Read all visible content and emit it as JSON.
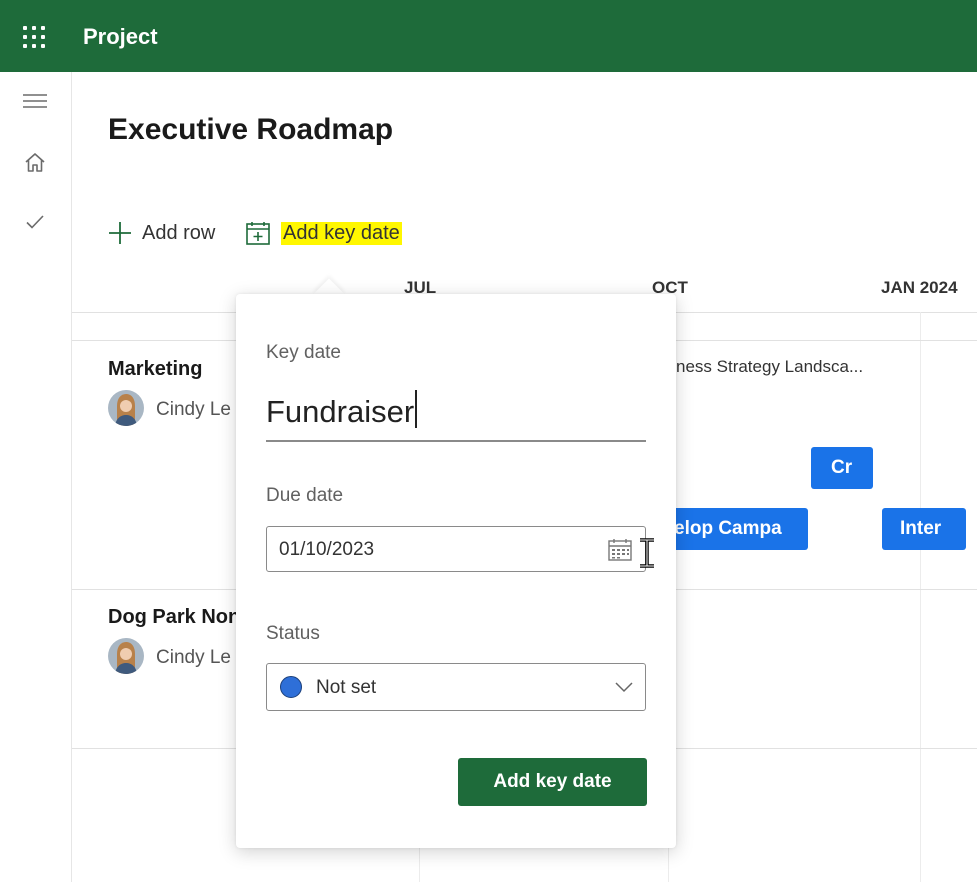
{
  "app": {
    "title": "Project"
  },
  "page": {
    "title": "Executive Roadmap"
  },
  "toolbar": {
    "add_row_label": "Add row",
    "add_key_date_label": "Add key date"
  },
  "timeline": {
    "months": [
      "JUL",
      "OCT",
      "JAN 2024"
    ]
  },
  "rows": [
    {
      "name": "Marketing",
      "owner": "Cindy Le",
      "bar_label": "ness Strategy Landsca...",
      "tasks": [
        "Cr",
        "elop Campa",
        "Inter"
      ]
    },
    {
      "name": "Dog Park Non",
      "owner": "Cindy Le"
    }
  ],
  "key_date_form": {
    "key_date_label": "Key date",
    "key_date_value": "Fundraiser",
    "due_date_label": "Due date",
    "due_date_value": "01/10/2023",
    "status_label": "Status",
    "status_value": "Not set",
    "submit_label": "Add key date"
  },
  "colors": {
    "brand": "#1e6b3a",
    "task_bar": "#1a73e8",
    "highlight": "#fff700",
    "status_dot": "#2e6fd8"
  },
  "icons": [
    "waffle-icon",
    "hamburger-icon",
    "home-icon",
    "checkmark-icon",
    "plus-icon",
    "calendar-add-icon",
    "calendar-icon",
    "chevron-down-icon",
    "text-cursor-icon"
  ]
}
